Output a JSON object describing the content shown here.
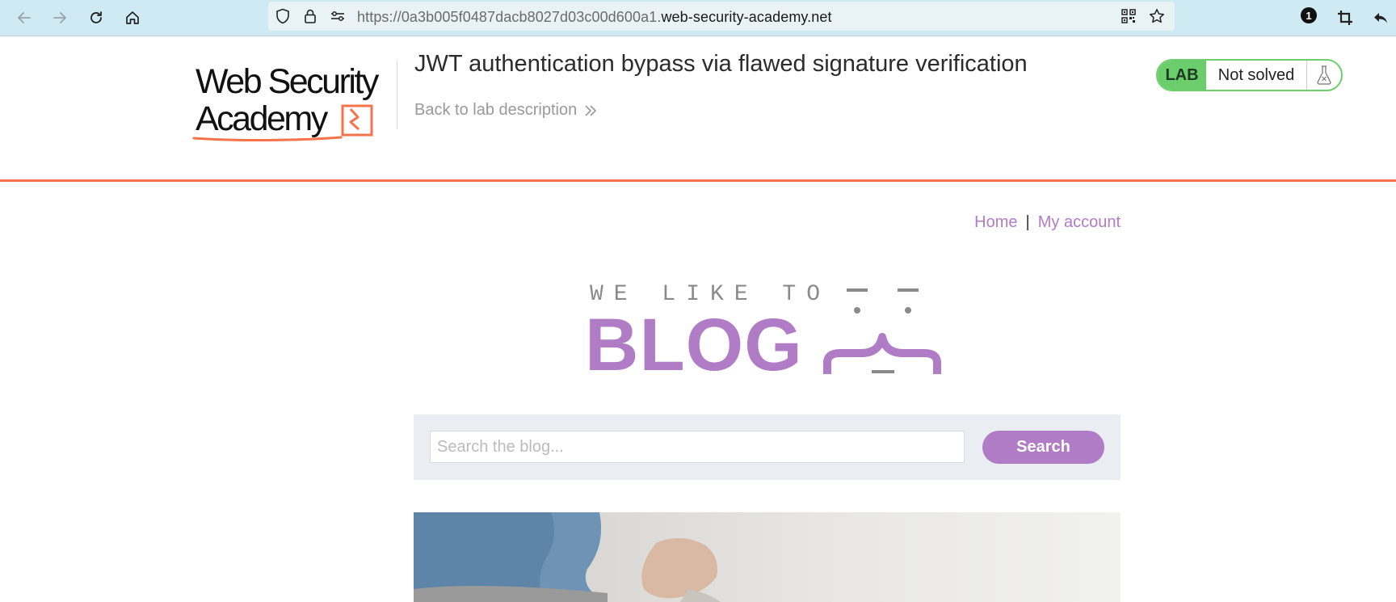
{
  "browser": {
    "url_prefix": "https://0a3b005f0487dacb8027d03c00d600a1.",
    "url_domain": "web-security-academy.net",
    "extension_badge": "1"
  },
  "lab_header": {
    "logo_line1": "Web Security",
    "logo_line2": "Academy",
    "title": "JWT authentication bypass via flawed signature verification",
    "back_link": "Back to lab description",
    "status_tag": "LAB",
    "status_text": "Not solved"
  },
  "nav": {
    "home": "Home",
    "separator": "|",
    "my_account": "My account"
  },
  "blog_logo": {
    "tagline": "WE LIKE TO",
    "word": "BLOG"
  },
  "search": {
    "placeholder": "Search the blog...",
    "value": "",
    "button_label": "Search"
  },
  "colors": {
    "accent_purple": "#b07cc6",
    "lab_green": "#6ccd6c",
    "header_rule": "#f4734b"
  },
  "icons": [
    "back-arrow-icon",
    "forward-arrow-icon",
    "reload-icon",
    "home-icon",
    "shield-icon",
    "lock-icon",
    "permissions-icon",
    "qr-code-icon",
    "bookmark-star-icon",
    "crop-icon",
    "share-back-icon",
    "flask-icon",
    "double-chevron-right-icon"
  ]
}
